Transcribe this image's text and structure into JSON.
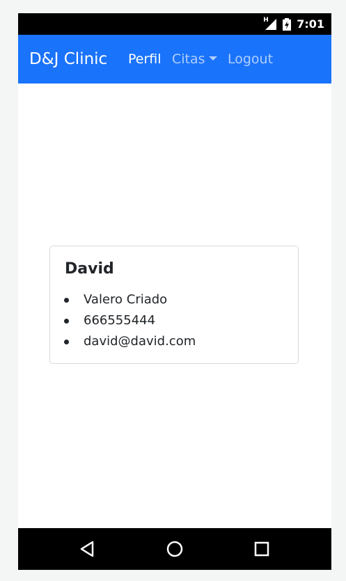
{
  "status_bar": {
    "time": "7:01",
    "network_label": "H"
  },
  "navbar": {
    "brand": "D&J Clinic",
    "items": [
      {
        "label": "Perfil",
        "active": true
      },
      {
        "label": "Citas",
        "dropdown": true
      },
      {
        "label": "Logout"
      }
    ]
  },
  "profile_card": {
    "name": "David",
    "details": [
      "Valero Criado",
      "666555444",
      "david@david.com"
    ]
  },
  "colors": {
    "accent": "#1a73fb",
    "text": "#212529",
    "muted_nav": "rgba(255,255,255,0.65)"
  },
  "icons": [
    "signal-icon",
    "battery-icon",
    "back-icon",
    "home-icon",
    "recents-icon"
  ]
}
